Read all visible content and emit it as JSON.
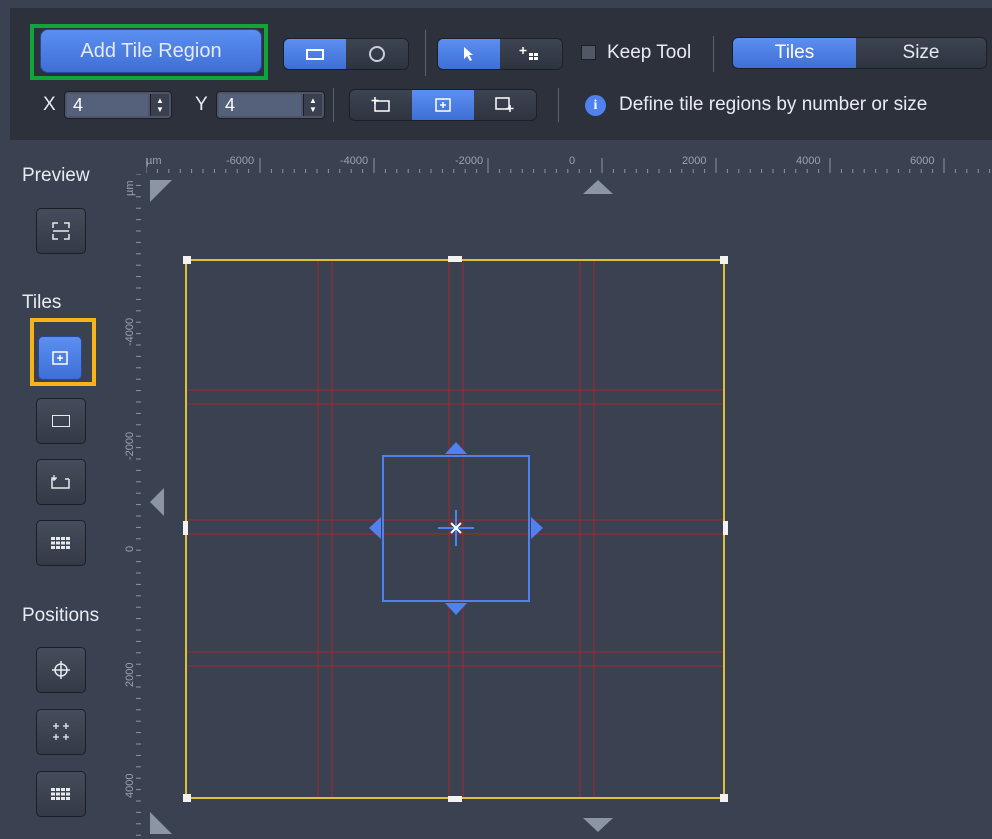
{
  "toolbar": {
    "add_tile_region_label": "Add Tile Region",
    "keep_tool_label": "Keep Tool",
    "tiles_tab_label": "Tiles",
    "size_tab_label": "Size",
    "x_label": "X",
    "x_value": "4",
    "y_label": "Y",
    "y_value": "4",
    "info_text": "Define tile regions by number or size"
  },
  "sidebar": {
    "preview_title": "Preview",
    "tiles_title": "Tiles",
    "positions_title": "Positions"
  },
  "ruler": {
    "unit": "µm",
    "x_ticks": [
      "-6000",
      "-4000",
      "-2000",
      "0",
      "2000",
      "4000",
      "6000"
    ],
    "y_ticks": [
      "-4000",
      "-2000",
      "0",
      "2000",
      "4000"
    ]
  },
  "colors": {
    "accent_blue": "#4f82ee",
    "tile_region_border": "#d9c237",
    "tile_grid": "#b0262c",
    "highlight_green": "#12a33a",
    "highlight_orange": "#f6b41a"
  }
}
